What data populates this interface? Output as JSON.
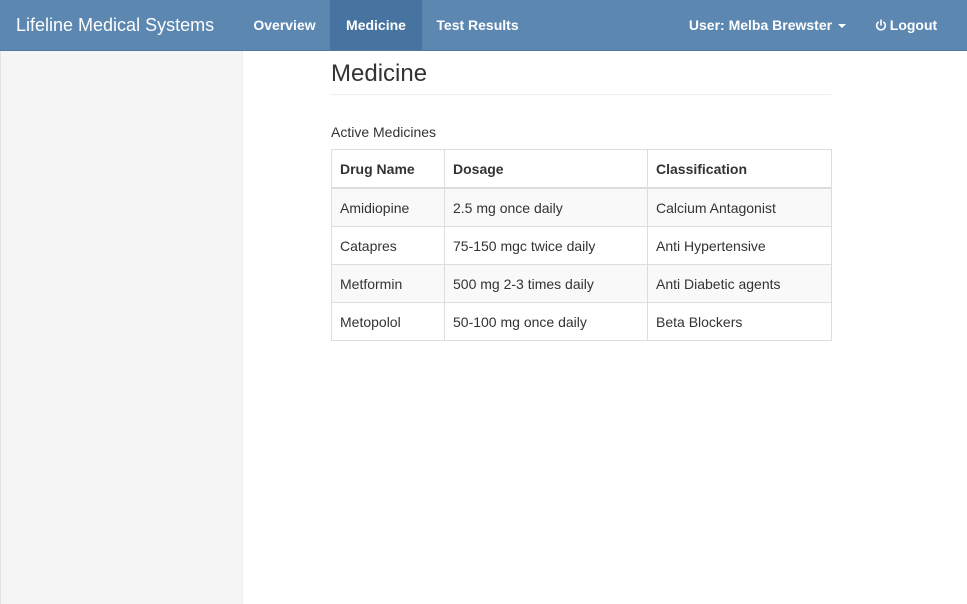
{
  "navbar": {
    "brand": "Lifeline Medical Systems",
    "links": [
      {
        "label": "Overview",
        "active": false
      },
      {
        "label": "Medicine",
        "active": true
      },
      {
        "label": "Test Results",
        "active": false
      }
    ],
    "user_label": "User: Melba Brewster",
    "logout_label": "Logout",
    "logout_icon": "power-icon",
    "colors": {
      "bar": "#5b87b1",
      "active": "#46739f"
    }
  },
  "main": {
    "title": "Medicine",
    "section_label": "Active Medicines",
    "table": {
      "headers": [
        "Drug Name",
        "Dosage",
        "Classification"
      ],
      "rows": [
        [
          "Amidiopine",
          "2.5 mg once daily",
          "Calcium Antagonist"
        ],
        [
          "Catapres",
          "75-150 mgc twice daily",
          "Anti Hypertensive"
        ],
        [
          "Metformin",
          "500 mg 2-3 times daily",
          "Anti Diabetic agents"
        ],
        [
          "Metopolol",
          "50-100 mg once daily",
          "Beta Blockers"
        ]
      ]
    }
  }
}
